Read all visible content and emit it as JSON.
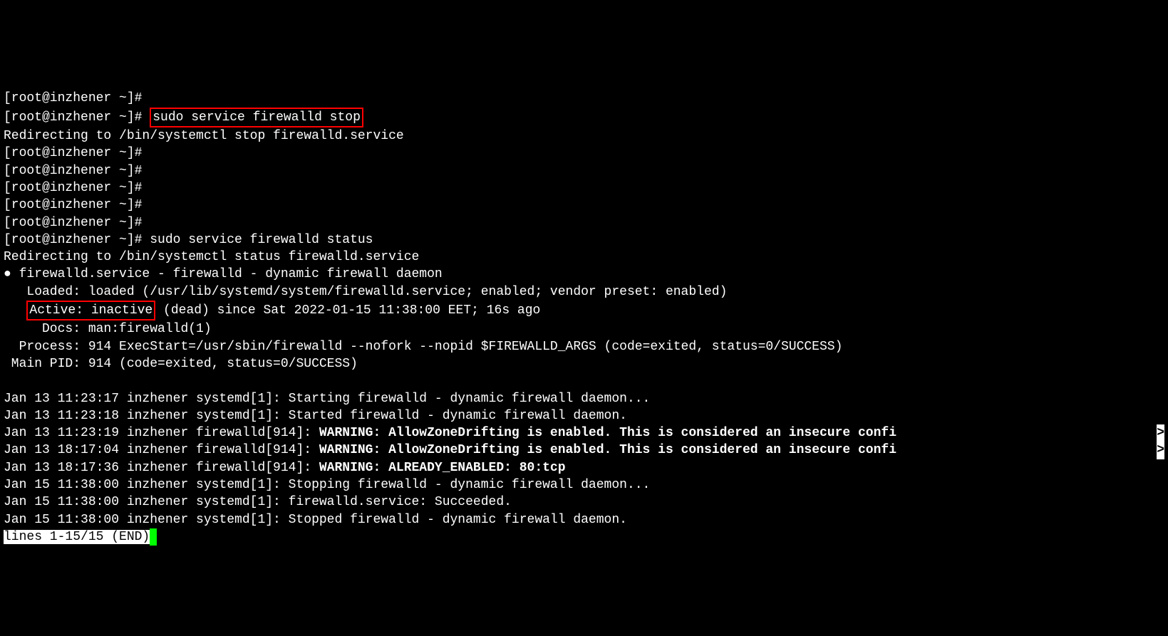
{
  "prompt_empty": "[root@inzhener ~]#",
  "prompt_filled": "[root@inzhener ~]# ",
  "cmd_stop": "sudo service firewalld stop",
  "redir_stop": "Redirecting to /bin/systemctl stop firewalld.service",
  "cmd_status": "sudo service firewalld status",
  "redir_status": "Redirecting to /bin/systemctl status firewalld.service",
  "svc_header": "● firewalld.service - firewalld - dynamic firewall daemon",
  "loaded_line": "   Loaded: loaded (/usr/lib/systemd/system/firewalld.service; enabled; vendor preset: enabled)",
  "active_pre": "   ",
  "active_box": "Active: inactive",
  "active_post": " (dead) since Sat 2022-01-15 11:38:00 EET; 16s ago",
  "docs_line": "     Docs: man:firewalld(1)",
  "process_line": "  Process: 914 ExecStart=/usr/sbin/firewalld --nofork --nopid $FIREWALLD_ARGS (code=exited, status=0/SUCCESS)",
  "mainpid_line": " Main PID: 914 (code=exited, status=0/SUCCESS)",
  "log1": "Jan 13 11:23:17 inzhener systemd[1]: Starting firewalld - dynamic firewall daemon...",
  "log2": "Jan 13 11:23:18 inzhener systemd[1]: Started firewalld - dynamic firewall daemon.",
  "log3_pre": "Jan 13 11:23:19 inzhener firewalld[914]: ",
  "log3_bold": "WARNING: AllowZoneDrifting is enabled. This is considered an insecure confi",
  "log4_pre": "Jan 13 18:17:04 inzhener firewalld[914]: ",
  "log4_bold": "WARNING: AllowZoneDrifting is enabled. This is considered an insecure confi",
  "log5_pre": "Jan 13 18:17:36 inzhener firewalld[914]: ",
  "log5_bold": "WARNING: ALREADY_ENABLED: 80:tcp",
  "log6": "Jan 15 11:38:00 inzhener systemd[1]: Stopping firewalld - dynamic firewall daemon...",
  "log7": "Jan 15 11:38:00 inzhener systemd[1]: firewalld.service: Succeeded.",
  "log8": "Jan 15 11:38:00 inzhener systemd[1]: Stopped firewalld - dynamic firewall daemon.",
  "overflow_marker": ">",
  "pager_status": "lines 1-15/15 (END)"
}
